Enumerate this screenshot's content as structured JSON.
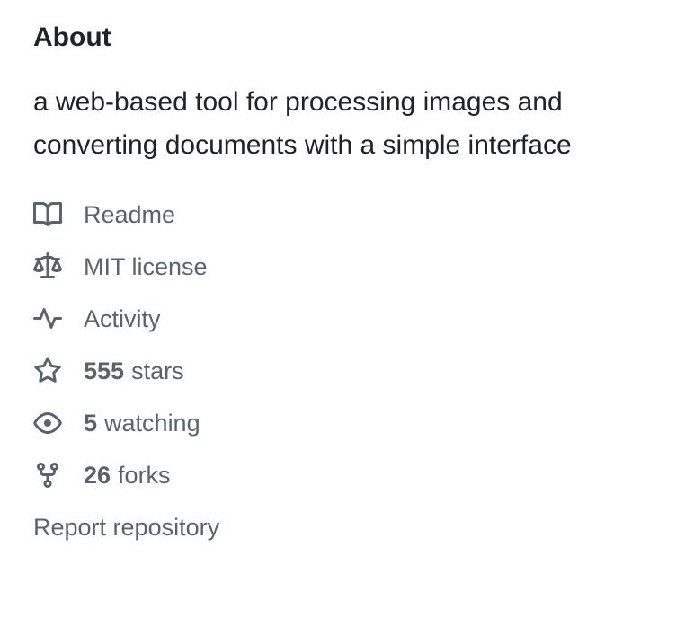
{
  "about": {
    "title": "About",
    "description": "a web-based tool for processing images and converting documents with a simple interface"
  },
  "links": {
    "readme": {
      "label": "Readme",
      "icon": "book-icon"
    },
    "license": {
      "label": "MIT license",
      "icon": "law-icon"
    },
    "activity": {
      "label": "Activity",
      "icon": "pulse-icon"
    },
    "stars": {
      "count": "555",
      "label": "stars",
      "icon": "star-icon"
    },
    "watching": {
      "count": "5",
      "label": "watching",
      "icon": "eye-icon"
    },
    "forks": {
      "count": "26",
      "label": "forks",
      "icon": "repo-forked-icon"
    }
  },
  "report": {
    "label": "Report repository"
  },
  "colors": {
    "text_primary": "#1f2328",
    "text_muted": "#59636e"
  }
}
